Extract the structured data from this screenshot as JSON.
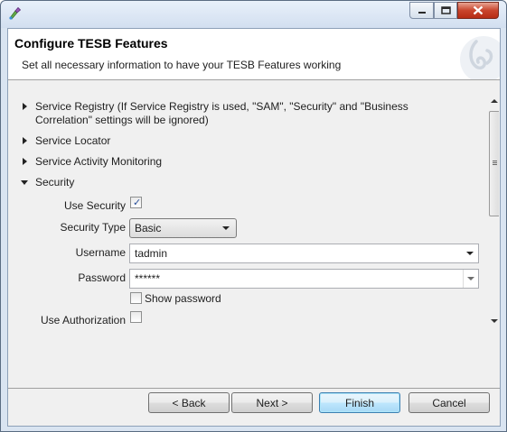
{
  "window": {
    "title": ""
  },
  "header": {
    "title": "Configure TESB Features",
    "description": "Set all necessary information to have your TESB Features working"
  },
  "sections": [
    {
      "label": "Service Registry (If Service Registry is used, \"SAM\", \"Security\" and \"Business Correlation\" settings will be ignored)",
      "expanded": false
    },
    {
      "label": "Service Locator",
      "expanded": false
    },
    {
      "label": "Service Activity Monitoring",
      "expanded": false
    },
    {
      "label": "Security",
      "expanded": true
    }
  ],
  "security": {
    "use_security_label": "Use Security",
    "use_security_checked": true,
    "security_type_label": "Security Type",
    "security_type_value": "Basic",
    "username_label": "Username",
    "username_value": "tadmin",
    "password_label": "Password",
    "password_value": "******",
    "show_password_label": "Show password",
    "show_password_checked": false,
    "use_authorization_label": "Use Authorization",
    "use_authorization_checked": false
  },
  "buttons": {
    "back": "< Back",
    "next": "Next >",
    "finish": "Finish",
    "cancel": "Cancel"
  },
  "colors": {
    "default_button_border": "#3c7fb1",
    "check_color": "#2a4f9a"
  },
  "icons": {
    "app": "palette-icon",
    "logo": "talend-logo-icon"
  }
}
